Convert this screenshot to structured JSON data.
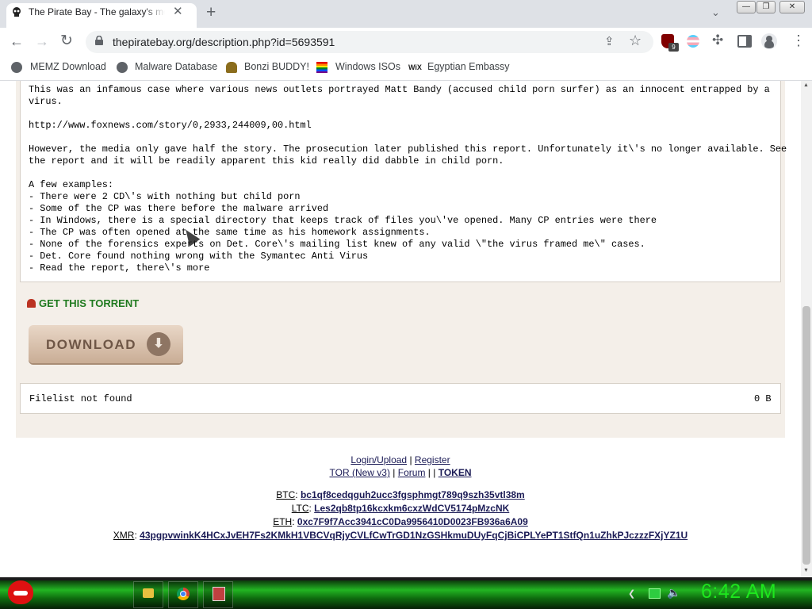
{
  "browser": {
    "tab_title": "The Pirate Bay - The galaxy's most resilient BitTorrent site",
    "tab_close": "✕",
    "new_tab": "+",
    "tab_search": "⌄",
    "url": "thepiratebay.org/description.php?id=5693591",
    "window_controls": {
      "minimize": "—",
      "maximize": "❐",
      "close": "✕"
    },
    "extension_badge": "9",
    "bookmarks": [
      {
        "label": "MEMZ Download",
        "icon": "globe-icon"
      },
      {
        "label": "Malware Database",
        "icon": "globe-icon"
      },
      {
        "label": "Bonzi BUDDY!",
        "icon": "bonzi-icon"
      },
      {
        "label": "Windows ISOs",
        "icon": "rainbow-flag-icon"
      },
      {
        "label": "Egyptian Embassy",
        "icon": "wix-icon"
      }
    ],
    "bookmark_wix_glyph": "WiX"
  },
  "page": {
    "description_lines": "This was an infamous case where various news outlets portrayed Matt Bandy (accused child porn surfer) as an innocent entrapped by a\nvirus.\n\nhttp://www.foxnews.com/story/0,2933,244009,00.html\n\nHowever, the media only gave half the story. The prosecution later published this report. Unfortunately it\\'s no longer available. See\nthe report and it will be readily apparent this kid really did dabble in child porn.\n\nA few examples:\n- There were 2 CD\\'s with nothing but child porn\n- Some of the CP was there before the malware arrived\n- In Windows, there is a special directory that keeps track of files you\\'ve opened. Many CP entries were there\n- The CP was often opened at the same time as his homework assignments.\n- None of the forensics experts on Det. Core\\'s mailing list knew of any valid \\\"the virus framed me\\\" cases.\n- Det. Core found nothing wrong with the Symantec Anti Virus\n- Read the report, there\\'s more",
    "get_torrent": "GET THIS TORRENT",
    "download_label": "DOWNLOAD",
    "filelist_text": "Filelist not found",
    "filelist_size": "0 B"
  },
  "footer": {
    "login_upload": "Login/Upload",
    "sep1": "|",
    "register": "Register",
    "tor": "TOR (New v3)",
    "sep2": "|",
    "forum": "Forum",
    "sep3": "| |",
    "token": "TOKEN",
    "btc_label": "BTC",
    "btc_addr": "bc1qf8cedqguh2ucc3fgsphmgt789q9szh35vtl38m",
    "ltc_label": "LTC",
    "ltc_addr": "Les2qb8tp16kcxkm6cxzWdCV5174pMzcNK",
    "eth_label": "ETH",
    "eth_addr": "0xc7F9f7Acc3941cC0Da9956410D0023FB936a6A09",
    "xmr_label": "XMR",
    "xmr_addr": "43pgpvwinkK4HCxJvEH7Fs2KMkH1VBCVqRjyCVLfCwTrGD1NzGSHkmuDUyFqCjBiCPLYePT1StfQn1uZhkPJczzzFXjYZ1U"
  },
  "taskbar": {
    "clock": "6:42 AM",
    "apps": [
      "file-explorer-icon",
      "chrome-icon",
      "app-icon"
    ]
  },
  "colors": {
    "page_bg": "#f4efe9",
    "torrent_green": "#1f7a1f",
    "taskbar_green": "#22b522",
    "clock_green": "#1ee61e"
  }
}
